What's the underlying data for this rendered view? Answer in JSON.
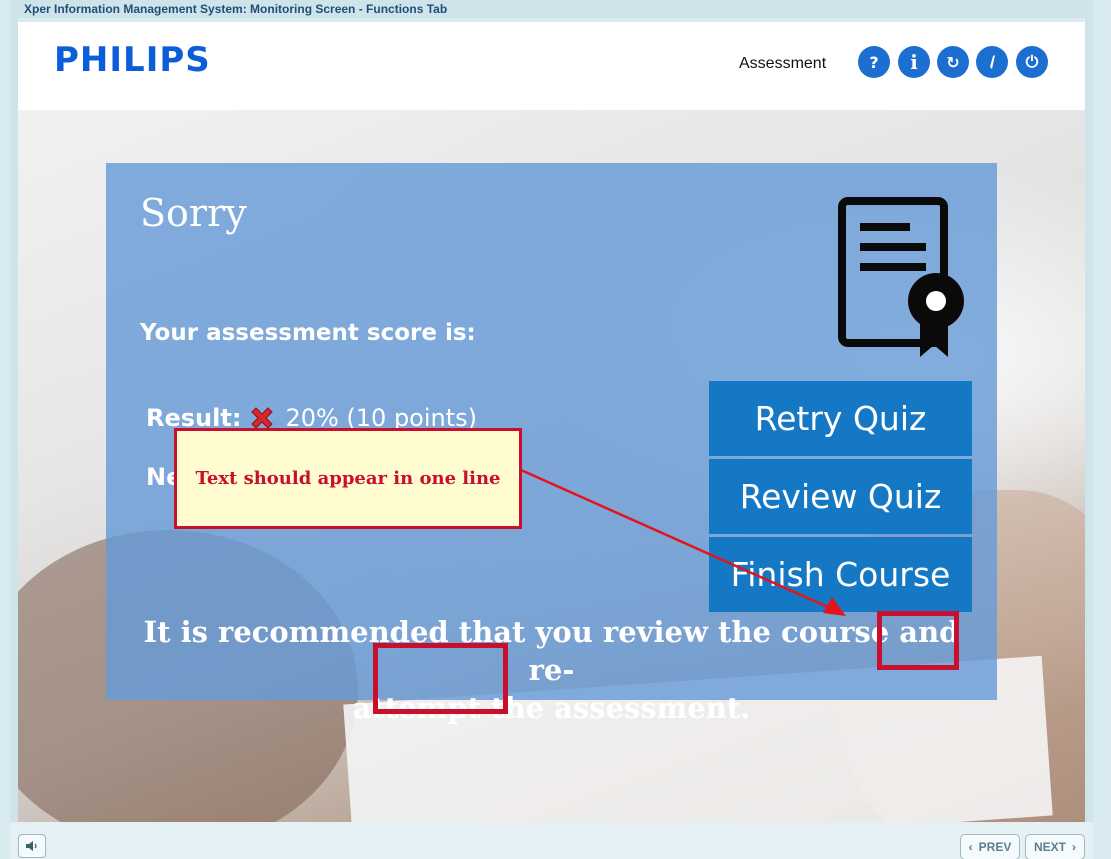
{
  "window": {
    "title": "Xper Information Management System: Monitoring Screen - Functions Tab"
  },
  "header": {
    "logo": "PHILIPS",
    "section": "Assessment",
    "buttons": [
      {
        "name": "help",
        "glyph": "?"
      },
      {
        "name": "info",
        "glyph": "i"
      },
      {
        "name": "replay",
        "glyph": "↻"
      },
      {
        "name": "compass",
        "glyph": ""
      },
      {
        "name": "power",
        "glyph": "⏻"
      }
    ]
  },
  "panel": {
    "title": "Sorry",
    "score_label": "Your assessment score is:",
    "result_label": "Result:",
    "result_value": "20% (10 points)",
    "next_label": "Ne",
    "buttons": [
      "Retry Quiz",
      "Review Quiz",
      "Finish Course"
    ],
    "recommendation_line1": "It is recommended that you review the course and re-",
    "recommendation_line2": "attempt the assessment."
  },
  "annotation": {
    "callout_text": "Text should appear in one line",
    "color": "#c8102e"
  },
  "footer": {
    "prev": "PREV",
    "next": "NEXT"
  },
  "colors": {
    "brand": "#0b5ed7",
    "panel": "#669bd7",
    "button": "#1478c4",
    "header_button": "#1c6fd1"
  }
}
